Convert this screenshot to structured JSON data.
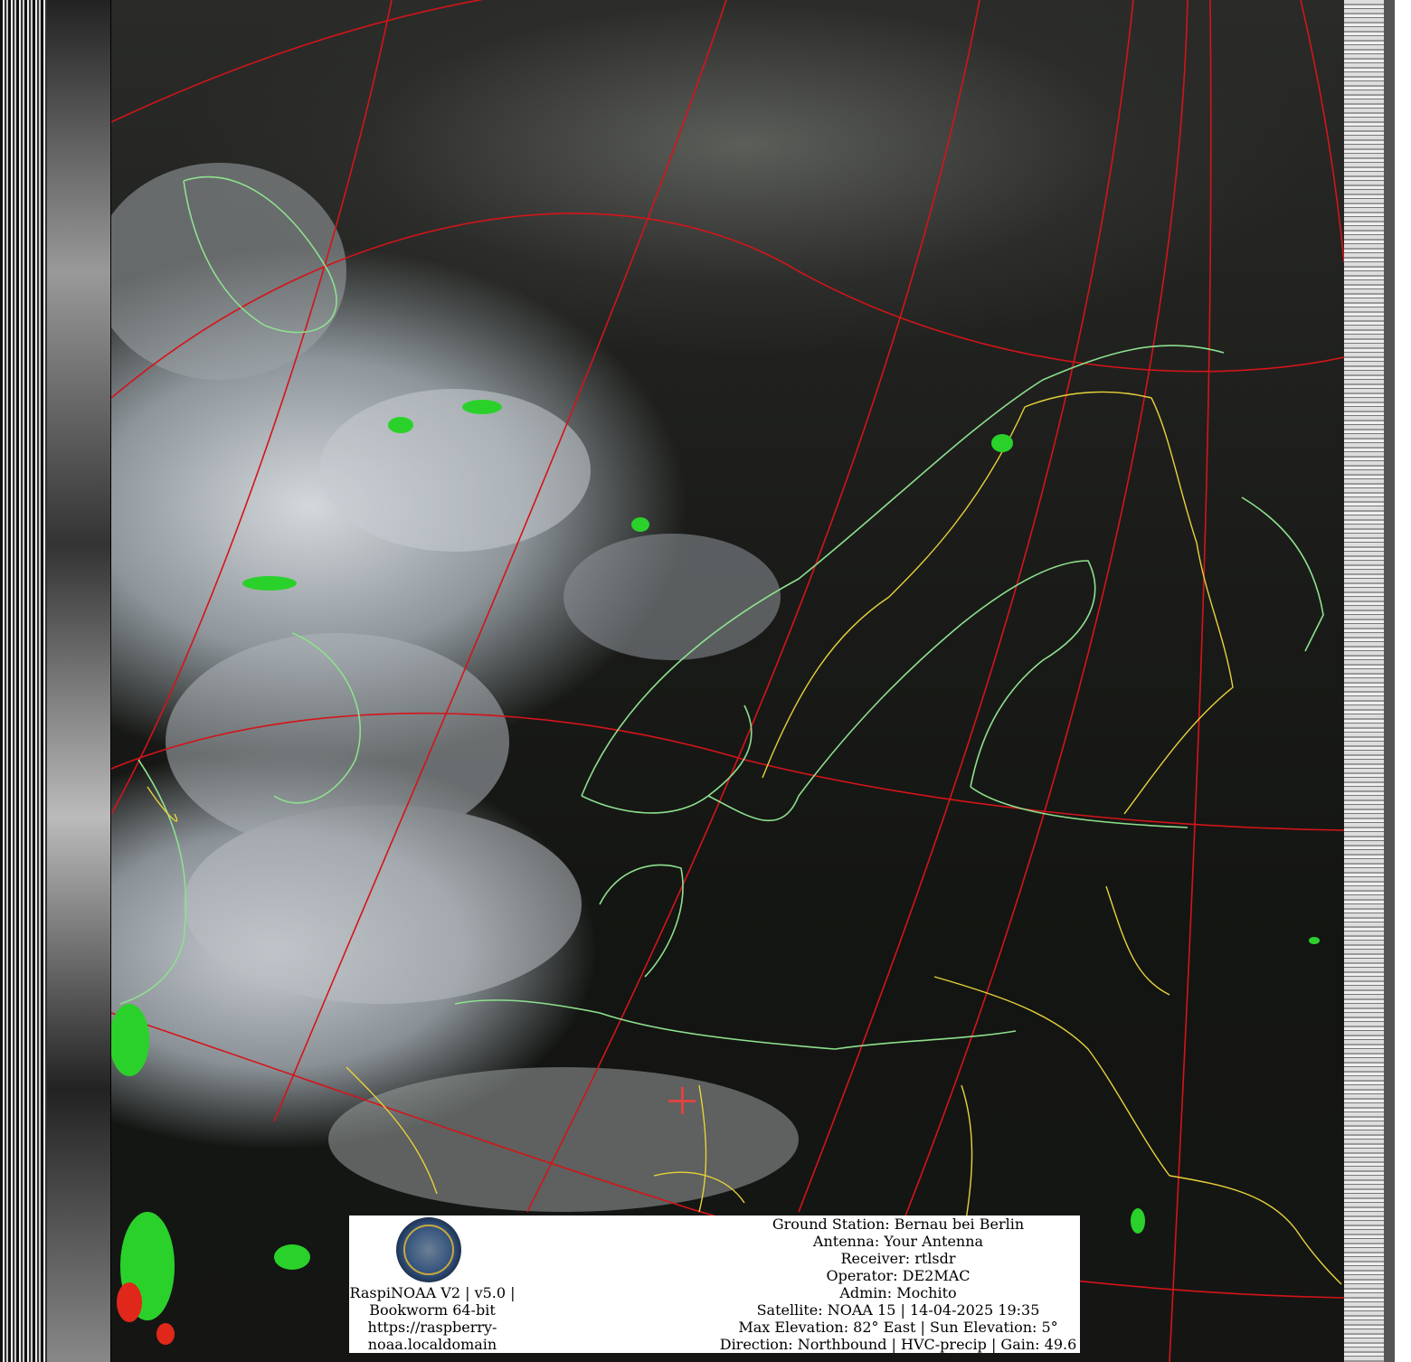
{
  "image": {
    "description_free": true,
    "overlay_colors": {
      "graticule": "#d4141a",
      "coastline": "#8ee08e",
      "borders": "#e8d23a",
      "precip_low": "#2bd12b",
      "precip_high": "#e0281a",
      "station_marker": "#d44a4a"
    },
    "logo_icon": "satellite-station-logo"
  },
  "footer": {
    "left_lines": [
      "RaspiNOAA V2 | v5.0 |",
      "Bookworm 64-bit",
      "https://raspberry-",
      "noaa.localdomain"
    ],
    "right_lines": [
      "Ground Station: Bernau bei Berlin",
      "Antenna: Your Antenna",
      "Receiver: rtlsdr",
      "Operator: DE2MAC",
      "Admin: Mochito",
      "Satellite: NOAA 15 | 14-04-2025 19:35",
      "Max Elevation: 82° East | Sun Elevation: 5°",
      "Direction: Northbound | HVC-precip | Gain: 49.6"
    ]
  }
}
